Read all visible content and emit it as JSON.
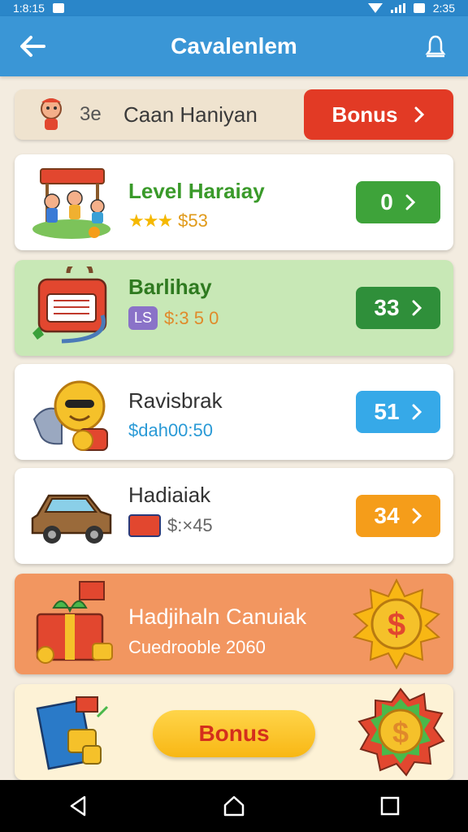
{
  "status_bar": {
    "time": "1:8:15",
    "battery": "2:35"
  },
  "app_bar": {
    "title": "Cavalenlem"
  },
  "player": {
    "number": "3e",
    "name": "Caan Haniyan",
    "bonus_label": "Bonus"
  },
  "cards": [
    {
      "title": "Level Haraiay",
      "sub_value": "$53",
      "button_label": "0",
      "title_color": "#3a9a2a",
      "sub_color": "#e09a1a",
      "button_color": "#3ea33a",
      "icon": "market-stall-icon"
    },
    {
      "title": "Barlihay",
      "badge": "LS",
      "sub_value": "$:3 5 0",
      "button_label": "33",
      "title_color": "#2f7a20",
      "sub_color": "#e08a2a",
      "button_color": "#2f8f3a",
      "icon": "mailbox-icon"
    },
    {
      "title": "Ravisbrak",
      "sub_value": "$dah00:50",
      "button_label": "51",
      "title_color": "#333333",
      "sub_color": "#2a9ad6",
      "button_color": "#36a9e8",
      "icon": "coin-character-icon"
    },
    {
      "title": "Hadiaiak",
      "sub_value": "$:×45",
      "button_label": "34",
      "title_color": "#333333",
      "sub_color": "#666666",
      "button_color": "#f59d1a",
      "icon": "car-icon"
    }
  ],
  "promo": {
    "title": "Hadjihaln Canuiak",
    "subtitle": "Cuedrooble 2060"
  },
  "bottom": {
    "bonus_label": "Bonus"
  },
  "colors": {
    "app_bar": "#3a96d6",
    "bonus_red": "#e23a25",
    "promo_orange": "#f29660"
  }
}
